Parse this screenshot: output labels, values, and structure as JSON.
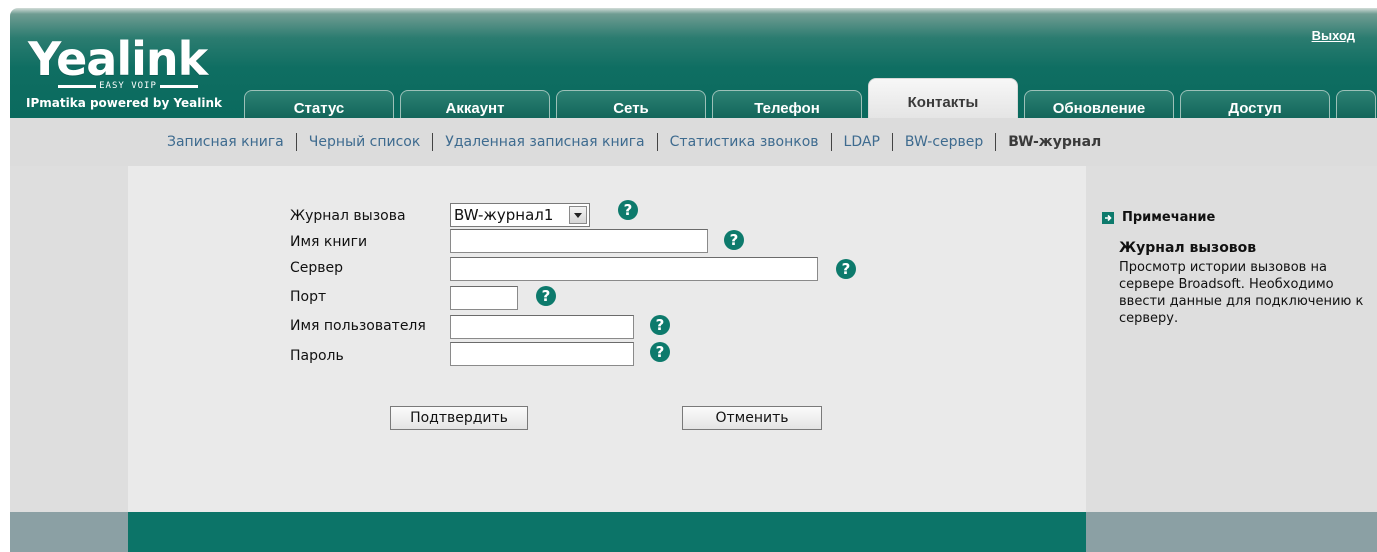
{
  "header": {
    "logo_text": "Yealink",
    "logo_tagline": "EASY VOIP",
    "logo_sub": "IPmatika powered by Yealink",
    "logout": "Выход"
  },
  "tabs": [
    {
      "label": "Статус",
      "active": false
    },
    {
      "label": "Аккаунт",
      "active": false
    },
    {
      "label": "Сеть",
      "active": false
    },
    {
      "label": "Телефон",
      "active": false
    },
    {
      "label": "Контакты",
      "active": true
    },
    {
      "label": "Обновление",
      "active": false
    },
    {
      "label": "Доступ",
      "active": false
    }
  ],
  "subnav": [
    {
      "label": "Записная книга",
      "active": false
    },
    {
      "label": "Черный список",
      "active": false
    },
    {
      "label": "Удаленная записная книга",
      "active": false
    },
    {
      "label": "Статистика звонков",
      "active": false
    },
    {
      "label": "LDAP",
      "active": false
    },
    {
      "label": "BW-сервер",
      "active": false
    },
    {
      "label": "BW-журнал",
      "active": true
    }
  ],
  "form": {
    "call_log_label": "Журнал вызова",
    "call_log_value": "BW-журнал1",
    "book_name_label": "Имя книги",
    "book_name_value": "",
    "server_label": "Сервер",
    "server_value": "",
    "port_label": "Порт",
    "port_value": "",
    "username_label": "Имя пользователя",
    "username_value": "",
    "password_label": "Пароль",
    "password_value": "",
    "help_symbol": "?",
    "confirm_button": "Подтвердить",
    "cancel_button": "Отменить"
  },
  "note": {
    "heading": "Примечание",
    "title": "Журнал вызовов",
    "text": "Просмотр истории вызовов на сервере Broadsoft. Необходимо ввести данные для подключению к серверу."
  },
  "colors": {
    "brand_teal": "#0c7468",
    "help_icon": "#0d7a6c",
    "link": "#3e6b8f"
  },
  "icons": {
    "help": "question-circle-icon",
    "note": "arrow-square-icon",
    "dropdown": "chevron-down-icon"
  }
}
